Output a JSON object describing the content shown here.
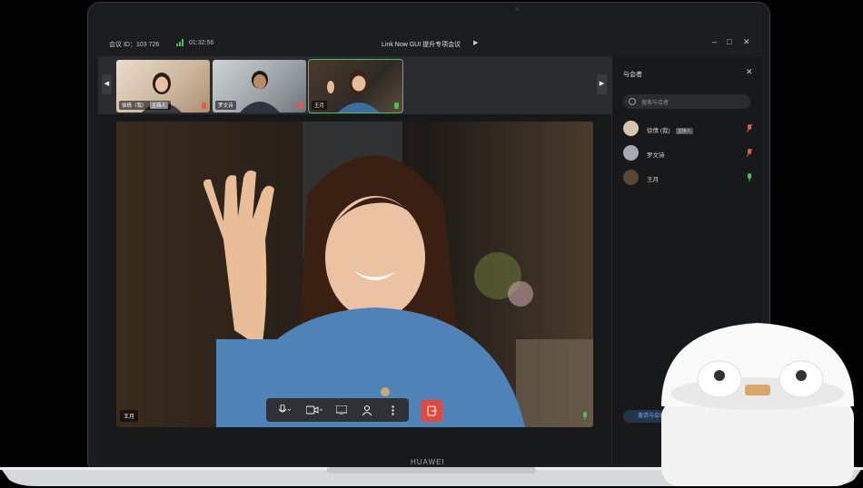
{
  "titlebar": {
    "meeting_id": "会议 ID：103 726",
    "duration": "01:32:56",
    "meeting_title": "Link Now GUI 提升专项会议",
    "min_glyph": "–",
    "max_glyph": "□",
    "close_glyph": "✕"
  },
  "participants_strip": [
    {
      "name": "徐倩（我）",
      "badge": "主持人",
      "mic": "muted"
    },
    {
      "name": "罗文诗",
      "badge": "",
      "mic": "muted"
    },
    {
      "name": "王月",
      "badge": "",
      "mic": "active"
    }
  ],
  "main_video": {
    "speaker_name": "王月"
  },
  "side_panel": {
    "title": "与会者",
    "search_placeholder": "搜索与会者",
    "participants": [
      {
        "name": "徐倩 (我)",
        "badge": "主持人",
        "mic": "muted"
      },
      {
        "name": "罗文诗",
        "badge": "",
        "mic": "muted"
      },
      {
        "name": "王月",
        "badge": "",
        "mic": "active"
      }
    ],
    "invite_label": "邀请与会者"
  },
  "device": {
    "brand": "HUAWEI"
  },
  "colors": {
    "accent_green": "#4cbf5a",
    "muted_red": "#e05a4f",
    "end_call": "#e24a3d",
    "link_blue": "#6ea8ff"
  },
  "icons": [
    "microphone-icon",
    "camera-icon",
    "share-screen-icon",
    "participants-icon",
    "more-icon",
    "end-call-icon"
  ]
}
